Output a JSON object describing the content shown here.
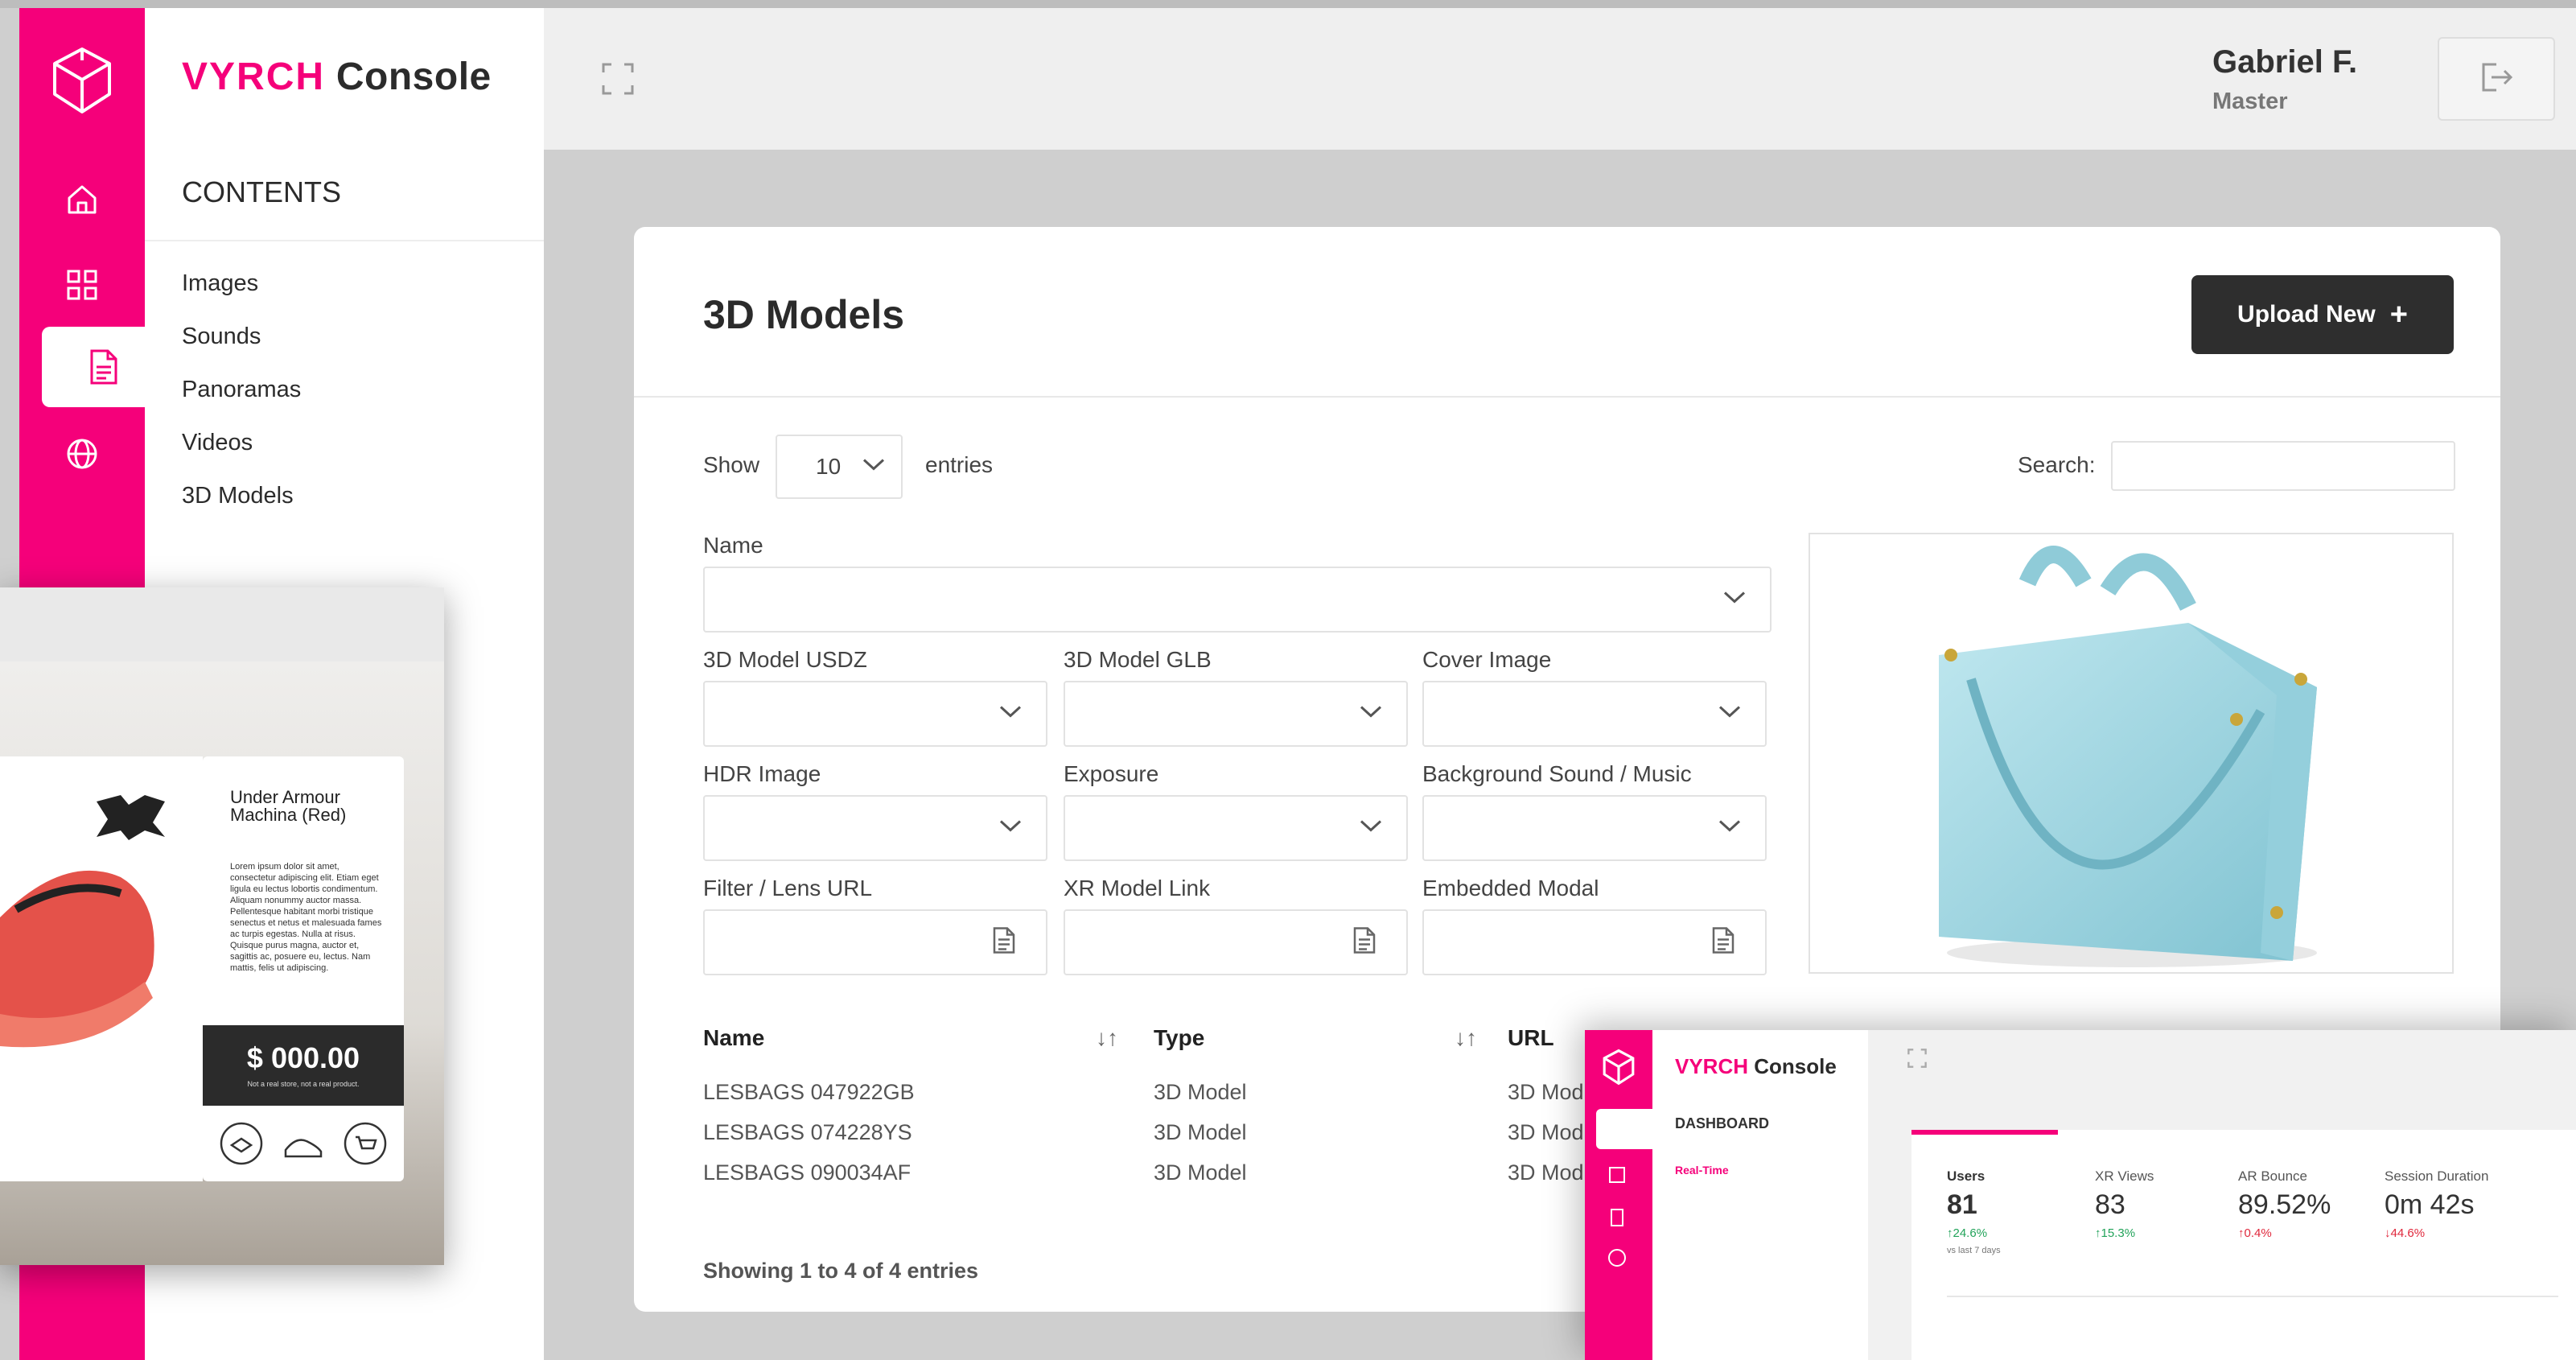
{
  "app": {
    "brand_main": "VYRCH",
    "brand_sub": "Console"
  },
  "user": {
    "name": "Gabriel F.",
    "role": "Master"
  },
  "sidebar": {
    "section_title": "CONTENTS",
    "items": [
      {
        "label": "Images"
      },
      {
        "label": "Sounds"
      },
      {
        "label": "Panoramas"
      },
      {
        "label": "Videos"
      },
      {
        "label": "3D Models",
        "active": true
      }
    ],
    "rail_icons": [
      "home-icon",
      "grid-icon",
      "document-icon",
      "globe-icon"
    ]
  },
  "page": {
    "title": "3D Models",
    "upload_label": "Upload New",
    "upload_icon": "+",
    "show_label": "Show",
    "entries_value": "10",
    "entries_label": "entries",
    "search_label": "Search:",
    "search_value": ""
  },
  "form": {
    "name_label": "Name",
    "usdz_label": "3D Model USDZ",
    "glb_label": "3D Model GLB",
    "cover_label": "Cover Image",
    "hdr_label": "HDR Image",
    "exposure_label": "Exposure",
    "bg_sound_label": "Background Sound / Music",
    "filter_label": "Filter / Lens URL",
    "xr_link_label": "XR Model Link",
    "embedded_label": "Embedded Modal"
  },
  "table": {
    "headers": [
      "Name",
      "Type",
      "URL"
    ],
    "sort_glyph": "↓↑",
    "rows": [
      {
        "name": "LESBAGS 047922GB",
        "type": "3D Model",
        "url": "3D Mod"
      },
      {
        "name": "LESBAGS 074228YS",
        "type": "3D Model",
        "url": "3D Mod"
      },
      {
        "name": "LESBAGS 090034AF",
        "type": "3D Model",
        "url": "3D Mod"
      }
    ],
    "footer": "Showing 1 to 4 of 4 entries"
  },
  "overlay_product": {
    "title": "Under Armour Machina (Red)",
    "description": "Lorem ipsum dolor sit amet, consectetur adipiscing elit. Etiam eget ligula eu lectus lobortis condimentum. Aliquam nonummy auctor massa. Pellentesque habitant morbi tristique senectus et netus et malesuada fames ac turpis egestas. Nulla at risus. Quisque purus magna, auctor et, sagittis ac, posuere eu, lectus. Nam mattis, felis ut adipiscing.",
    "price": "$ 000.00",
    "price_note": "Not a real store, not a real product."
  },
  "overlay_dashboard": {
    "brand_main": "VYRCH",
    "brand_sub": "Console",
    "section": "DASHBOARD",
    "sub_item": "Real-Time",
    "stats": [
      {
        "label": "Users",
        "value": "81",
        "delta": "↑24.6%",
        "delta_color": "#22a35a",
        "note": "vs last 7 days"
      },
      {
        "label": "XR Views",
        "value": "83",
        "delta": "↑15.3%",
        "delta_color": "#22a35a",
        "note": ""
      },
      {
        "label": "AR Bounce",
        "value": "89.52%",
        "delta": "↑0.4%",
        "delta_color": "#e0283c",
        "note": ""
      },
      {
        "label": "Session Duration",
        "value": "0m 42s",
        "delta": "↓44.6%",
        "delta_color": "#e0283c",
        "note": ""
      }
    ]
  },
  "colors": {
    "accent": "#f5007a",
    "dark_button": "#2e2e2e",
    "canvas": "#cfcfcf"
  }
}
